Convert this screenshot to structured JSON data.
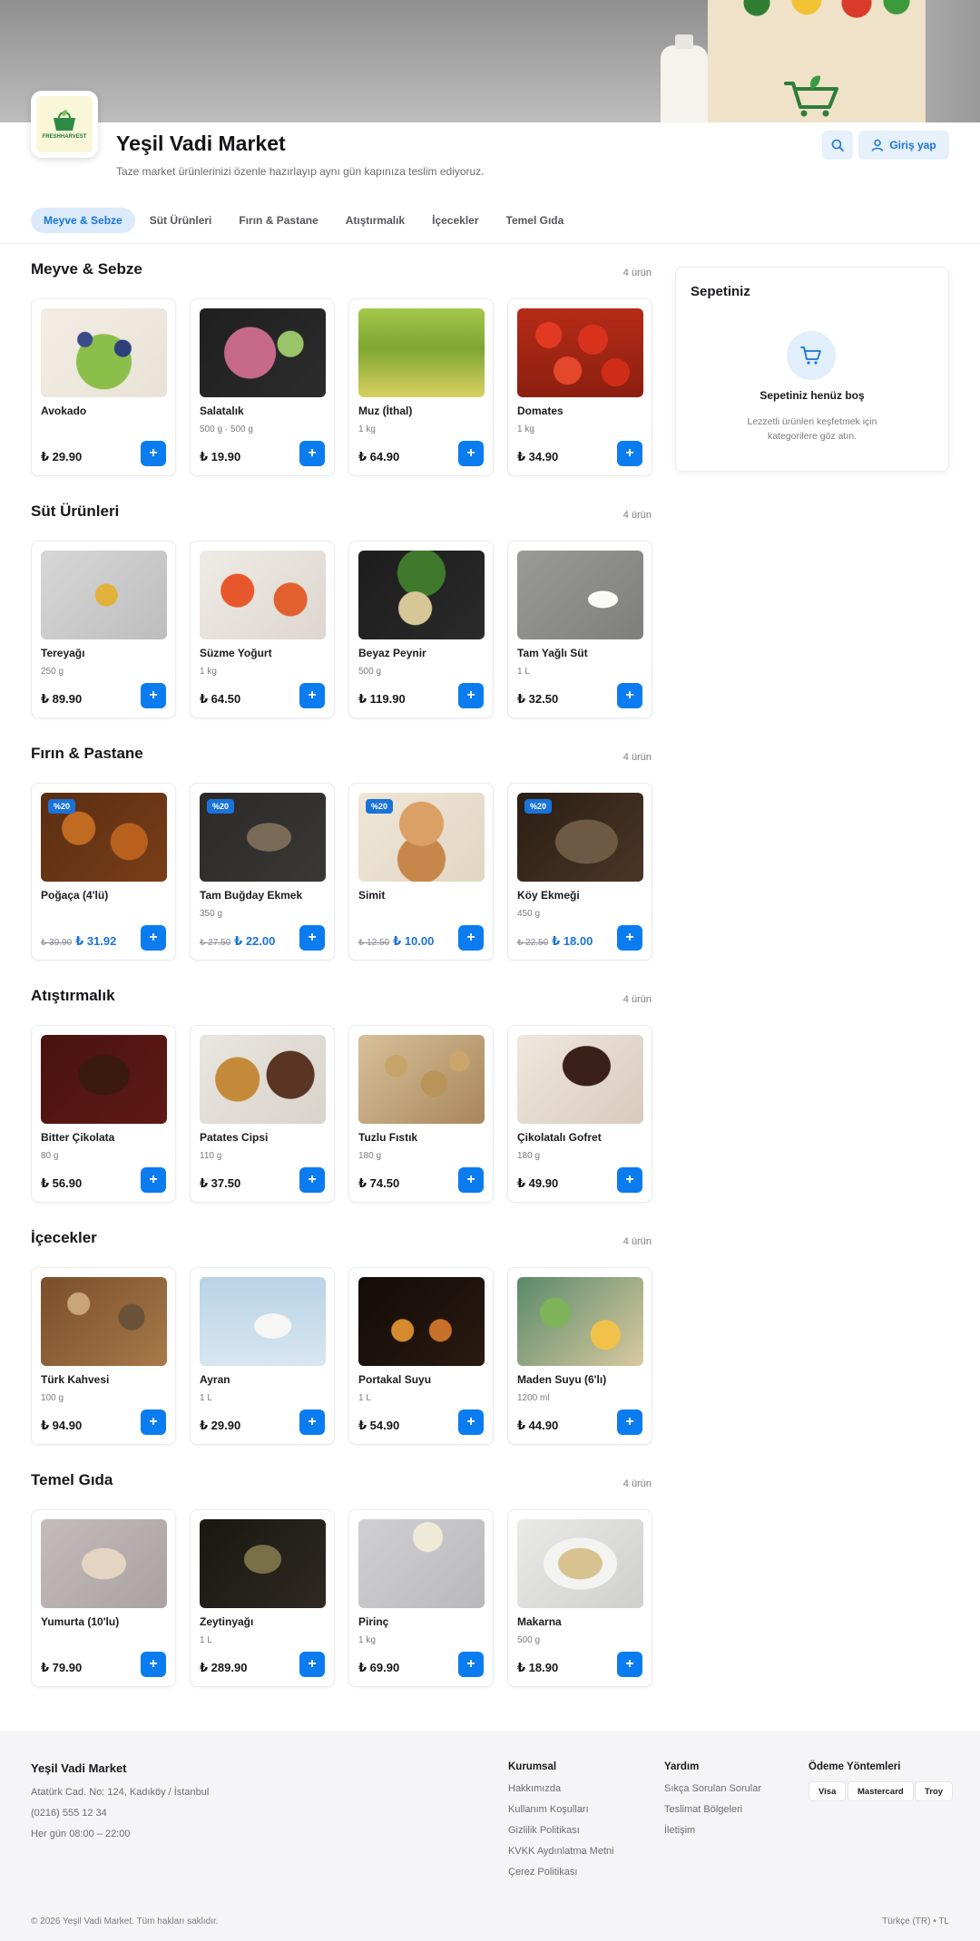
{
  "store": {
    "title": "Yeşil Vadi Market",
    "subtitle": "Taze market ürünlerinizi özenle hazırlayıp aynı gün kapınıza teslim ediyoruz.",
    "logo_text": "FRESHHARVEST",
    "login_label": "Giriş yap"
  },
  "tabs": [
    "Meyve & Sebze",
    "Süt Ürünleri",
    "Fırın & Pastane",
    "Atıştırmalık",
    "İçecekler",
    "Temel Gıda"
  ],
  "sections": [
    {
      "title": "Meyve & Sebze",
      "count": "4 ürün",
      "products": [
        {
          "name": "Avokado",
          "weight": "",
          "price": "₺ 29.90",
          "img": "avocado"
        },
        {
          "name": "Salatalık",
          "weight": "500 g · 500 g",
          "price": "₺ 19.90",
          "img": "cucumber"
        },
        {
          "name": "Muz (İthal)",
          "weight": "1 kg",
          "price": "₺ 64.90",
          "img": "banana"
        },
        {
          "name": "Domates",
          "weight": "1 kg",
          "price": "₺ 34.90",
          "img": "tomato"
        }
      ]
    },
    {
      "title": "Süt Ürünleri",
      "count": "4 ürün",
      "products": [
        {
          "name": "Tereyağı",
          "weight": "250 g",
          "price": "₺ 89.90",
          "img": "butter"
        },
        {
          "name": "Süzme Yoğurt",
          "weight": "1 kg",
          "price": "₺ 64.50",
          "img": "yogurt"
        },
        {
          "name": "Beyaz Peynir",
          "weight": "500 g",
          "price": "₺ 119.90",
          "img": "cheese"
        },
        {
          "name": "Tam Yağlı Süt",
          "weight": "1 L",
          "price": "₺ 32.50",
          "img": "milk"
        }
      ]
    },
    {
      "title": "Fırın & Pastane",
      "count": "4 ürün",
      "products": [
        {
          "name": "Poğaça (4'lü)",
          "weight": "",
          "badge": "%20",
          "old_price": "₺ 39.90",
          "price": "₺ 31.92",
          "img": "bun"
        },
        {
          "name": "Tam Buğday Ekmek",
          "weight": "350 g",
          "badge": "%20",
          "old_price": "₺ 27.50",
          "price": "₺ 22.00",
          "img": "wheat"
        },
        {
          "name": "Simit",
          "weight": "",
          "badge": "%20",
          "old_price": "₺ 12.50",
          "price": "₺ 10.00",
          "img": "simit"
        },
        {
          "name": "Köy Ekmeği",
          "weight": "450 g",
          "badge": "%20",
          "old_price": "₺ 22.50",
          "price": "₺ 18.00",
          "img": "bread"
        }
      ]
    },
    {
      "title": "Atıştırmalık",
      "count": "4 ürün",
      "products": [
        {
          "name": "Bitter Çikolata",
          "weight": "80 g",
          "price": "₺ 56.90",
          "img": "choco"
        },
        {
          "name": "Patates Cipsi",
          "weight": "110 g",
          "price": "₺ 37.50",
          "img": "chips"
        },
        {
          "name": "Tuzlu Fıstık",
          "weight": "180 g",
          "price": "₺ 74.50",
          "img": "peanut"
        },
        {
          "name": "Çikolatalı Gofret",
          "weight": "180 g",
          "price": "₺ 49.90",
          "img": "wafer"
        }
      ]
    },
    {
      "title": "İçecekler",
      "count": "4 ürün",
      "products": [
        {
          "name": "Türk Kahvesi",
          "weight": "100 g",
          "price": "₺ 94.90",
          "img": "coffee"
        },
        {
          "name": "Ayran",
          "weight": "1 L",
          "price": "₺ 29.90",
          "img": "ayran"
        },
        {
          "name": "Portakal Suyu",
          "weight": "1 L",
          "price": "₺ 54.90",
          "img": "juice"
        },
        {
          "name": "Maden Suyu (6'lı)",
          "weight": "1200 ml",
          "price": "₺ 44.90",
          "img": "soda"
        }
      ]
    },
    {
      "title": "Temel Gıda",
      "count": "4 ürün",
      "products": [
        {
          "name": "Yumurta (10'lu)",
          "weight": "",
          "price": "₺ 79.90",
          "img": "egg"
        },
        {
          "name": "Zeytinyağı",
          "weight": "1 L",
          "price": "₺ 289.90",
          "img": "oil"
        },
        {
          "name": "Pirinç",
          "weight": "1 kg",
          "price": "₺ 69.90",
          "img": "rice"
        },
        {
          "name": "Makarna",
          "weight": "500 g",
          "price": "₺ 18.90",
          "img": "pasta"
        }
      ]
    }
  ],
  "cart": {
    "title": "Sepetiniz",
    "empty": "Sepetiniz henüz boş",
    "hint": "Lezzetli ürünleri keşfetmek için kategorilere göz atın."
  },
  "footer": {
    "brand": "Yeşil Vadi Market",
    "address": "Atatürk Cad. No: 124, Kadıköy / İstanbul",
    "phone": "(0216) 555 12 34",
    "hours": "Her gün 08:00 – 22:00",
    "corporate_title": "Kurumsal",
    "corporate_links": [
      "Hakkımızda",
      "Kullanım Koşulları",
      "Gizlilik Politikası",
      "KVKK Aydınlatma Metni",
      "Çerez Politikası"
    ],
    "help_title": "Yardım",
    "help_links": [
      "Sıkça Sorulan Sorular",
      "Teslimat Bölgeleri",
      "İletişim"
    ],
    "payment_title": "Ödeme Yöntemleri",
    "payments": [
      "Visa",
      "Mastercard",
      "Troy"
    ],
    "copyright": "© 2026 Yeşil Vadi Market. Tüm hakları saklıdır.",
    "language": "Türkçe (TR) • TL"
  },
  "colors": {
    "accent": "#0a7cf0",
    "accent_soft": "#dcebfb",
    "brand_green": "#1e7a3a"
  }
}
